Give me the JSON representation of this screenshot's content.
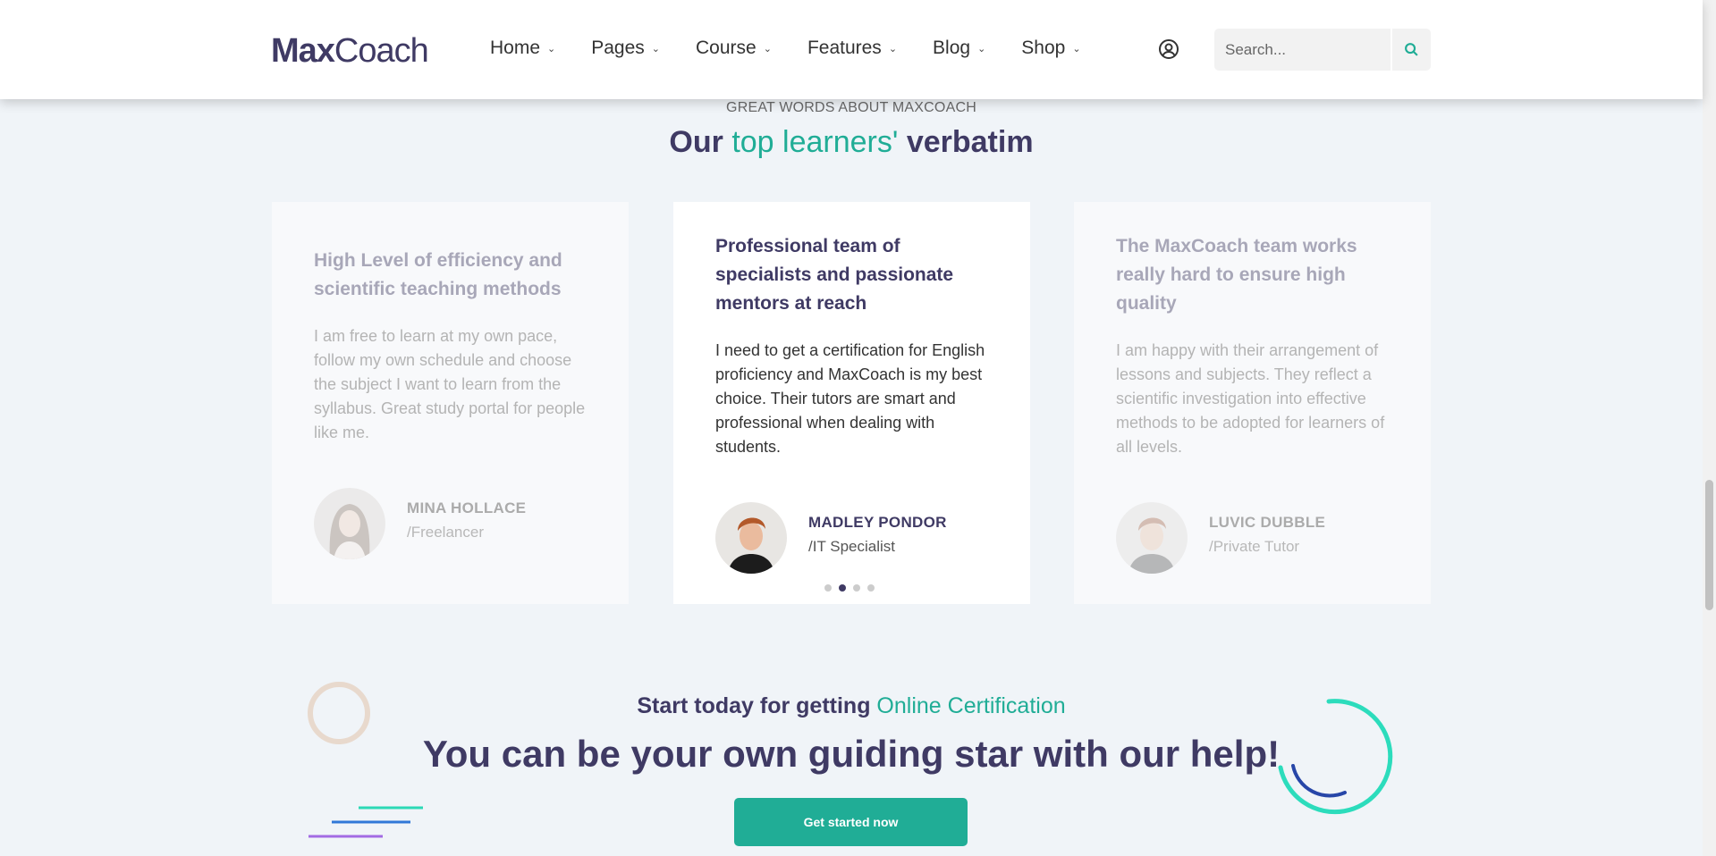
{
  "header": {
    "logo_bold": "Max",
    "logo_light": "Coach",
    "nav": [
      "Home",
      "Pages",
      "Course",
      "Features",
      "Blog",
      "Shop"
    ],
    "search_placeholder": "Search..."
  },
  "testimonials": {
    "eyebrow": "GREAT WORDS ABOUT MAXCOACH",
    "title_pre": "Our",
    "title_accent": "top learners'",
    "title_post": "verbatim",
    "cards": [
      {
        "heading": "High Level of efficiency and scientific teaching methods",
        "body": "I am free to learn at my own pace, follow my own schedule and choose the subject I want to learn from the syllabus. Great study portal for people like me.",
        "name": "MINA HOLLACE",
        "role": "/Freelancer"
      },
      {
        "heading": "Professional team of specialists and passionate mentors at reach",
        "body": "I need to get a certification for English proficiency and MaxCoach is my best choice. Their tutors are smart and professional when dealing with students.",
        "name": "MADLEY PONDOR",
        "role": "/IT Specialist"
      },
      {
        "heading": "The MaxCoach team works really hard to ensure high quality",
        "body": "I am happy with their arrangement of lessons and subjects. They reflect a scientific investigation into effective methods to be adopted for learners of all levels.",
        "name": "LUVIC DUBBLE",
        "role": "/Private Tutor"
      }
    ],
    "active_dot": 1,
    "dot_count": 4
  },
  "cta": {
    "sub_pre": "Start today for getting",
    "sub_accent": "Online Certification",
    "title": "You can be your own guiding star with our help!",
    "button": "Get started now"
  },
  "colors": {
    "primary": "#3f3a64",
    "accent": "#20ad96",
    "background": "#f0f4f8"
  }
}
